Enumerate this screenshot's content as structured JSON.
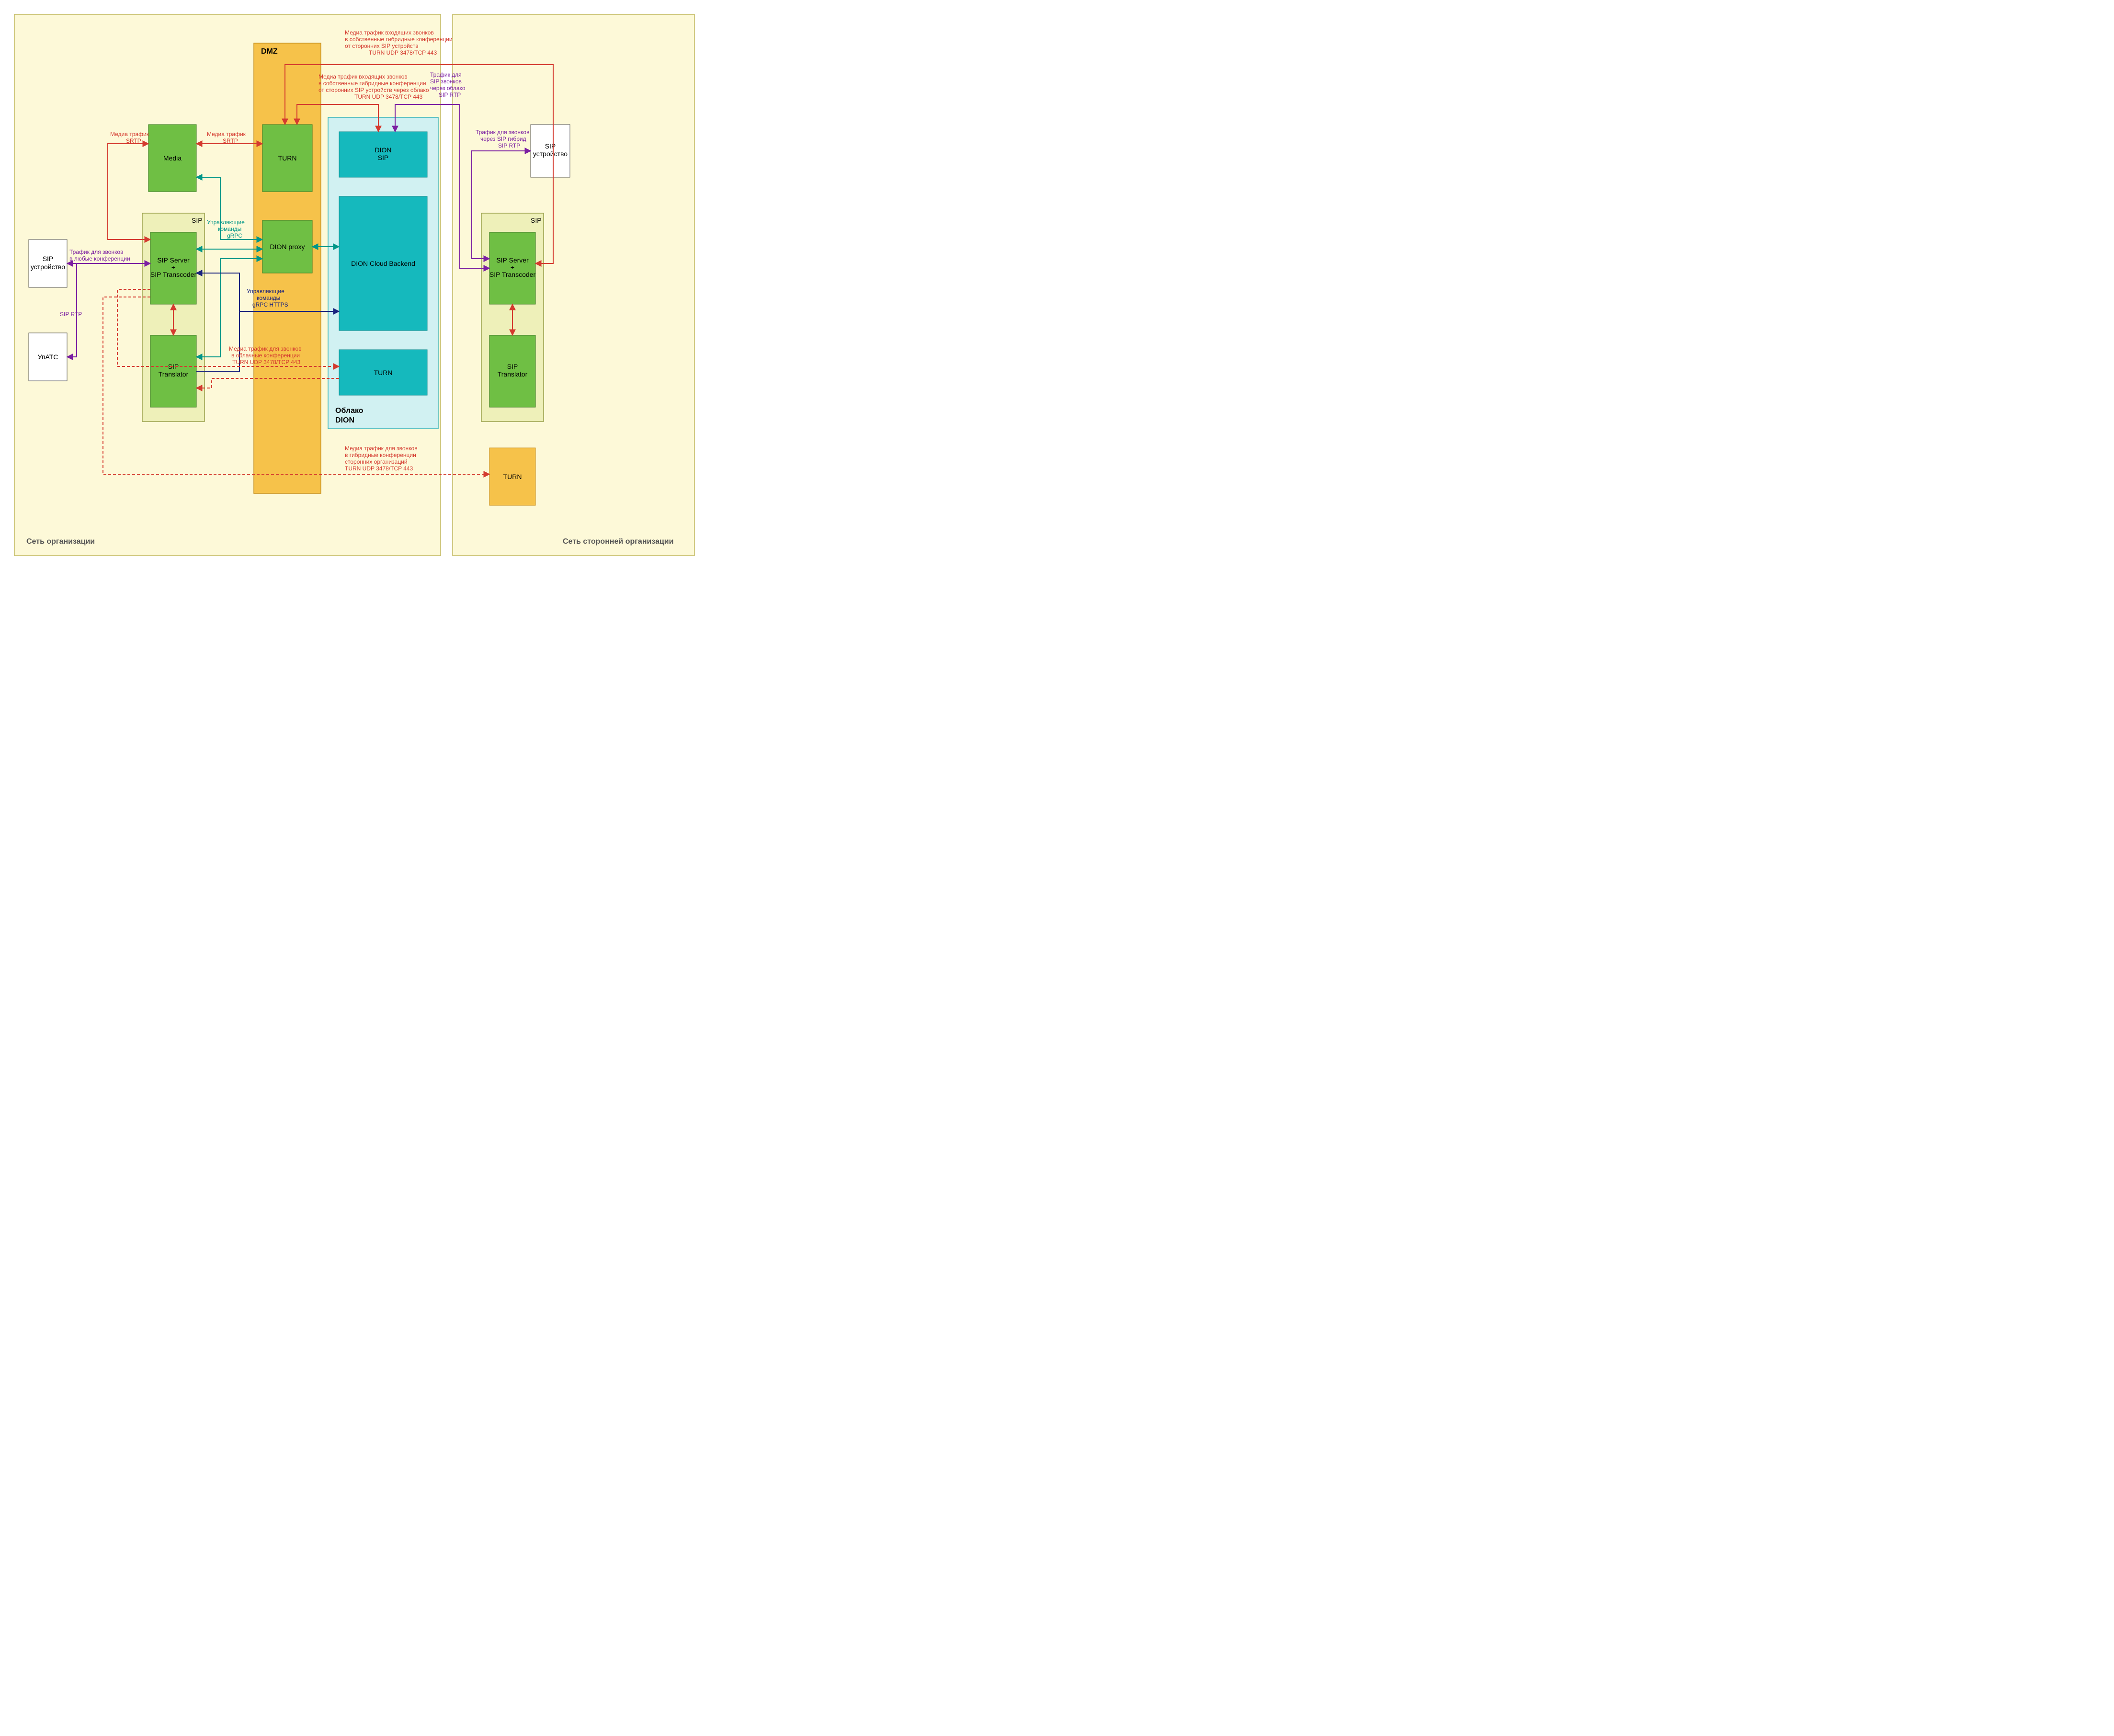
{
  "zones": {
    "org": "Сеть организации",
    "ext": "Сеть сторонней организации",
    "dmz": "DMZ",
    "cloud": "Облако\nDION",
    "sip_local": "SIP",
    "sip_ext": "SIP"
  },
  "nodes": {
    "sip_dev": "SIP\nустройство",
    "upats": "УпАТС",
    "media": "Media",
    "sip_srv": "SIP Server\n+\nSIP Transcoder",
    "sip_trans": "SIP\nTranslator",
    "turn_dmz": "TURN",
    "dproxy": "DION proxy",
    "dion_sip": "DION\nSIP",
    "dion_be": "DION Cloud Backend",
    "turn_cloud": "TURN",
    "sip_dev_ext": "SIP\nустройство",
    "sip_srv_ext": "SIP Server\n+\nSIP Transcoder",
    "sip_trans_ext": "SIP\nTranslator",
    "turn_ext": "TURN"
  },
  "edges": {
    "media_l": "Медиа трафик\nSRTP",
    "media_r": "Медиа трафик\nSRTP",
    "grpc": "Управляющие\nкоманды\ngRPC",
    "grpc_https": "Управляющие\nкоманды\ngRPC HTTPS",
    "sip_any": "Трафик для звонков\nв любые конференции",
    "sip_rtp": "SIP RTP",
    "cloud_conf": "Медиа трафик для звонков\nв облачные конференции\nTURN UDP 3478/TCP 443",
    "hybrid_ext": "Медиа трафик для звонков\nв гибридные конференции\nсторонних организаций\nTURN UDP 3478/TCP 443",
    "in_hybrid": "Медиа трафик входящих звонков\nв собственные гибридные конференции\nот сторонних SIP устройств\nTURN UDP 3478/TCP 443",
    "in_hybrid_cloud": "Медиа трафик входящих звонков\nв собственные гибридные конференции\nот сторонних SIP устройств через облако\nTURN UDP 3478/TCP 443",
    "sip_cloud": "Трафик для\nSIP звонков\nчерез облако\nSIP RTP",
    "sip_hybrid_ext": "Трафик для звонков\nчерез SIP гибрид\nSIP RTP"
  }
}
